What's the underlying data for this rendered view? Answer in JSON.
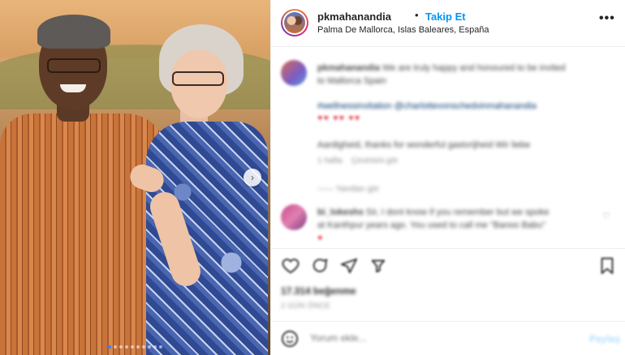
{
  "header": {
    "username": "pkmahanandia",
    "separator": "•",
    "follow_label": "Takip Et",
    "location": "Palma De Mallorca, Islas Baleares, España",
    "more_icon": "more-options-icon"
  },
  "caption": {
    "author": "pkmahanandia",
    "line1": "We are truly happy and honoured to be invited",
    "line2": "to Mallorca Spain",
    "mentions": "#wellnessinvitation @charlottevonschedvinmahanandia",
    "hearts": "♥♥ ♥♥ ♥♥",
    "line3": "Aardigheid, thanks for wonderful gastvrijheid Wir liebe",
    "meta_time": "1 hafta",
    "meta_translate": "Çevirisini gör"
  },
  "replies_toggle": "—— Yanıtları gör",
  "comment2": {
    "author": "bi_lokeshs",
    "line1": "Sir, I dont know if you remember but we spoke",
    "line2": "at Kanthpur years ago. You used to call me \"Banoo Babu\"",
    "hearts": "♥",
    "like_icon": "heart-outline-icon"
  },
  "actions": {
    "like_icon": "heart-outline-icon",
    "comment_icon": "comment-bubble-icon",
    "share_icon": "paper-plane-icon",
    "save_icon": "bookmark-icon"
  },
  "likes": "17.314 beğenme",
  "date": "2 GÜN ÖNCE",
  "add_comment": {
    "emoji_icon": "emoji-smiley-icon",
    "placeholder": "Yorum ekle...",
    "post_label": "Paylaş"
  },
  "carousel": {
    "next_icon": "chevron-right-icon",
    "next_glyph": "›",
    "slides": 10,
    "active": 1
  },
  "colors": {
    "follow": "#0095f6",
    "post_disabled": "#b2dffc",
    "carousel_active": "#3b82f6"
  }
}
